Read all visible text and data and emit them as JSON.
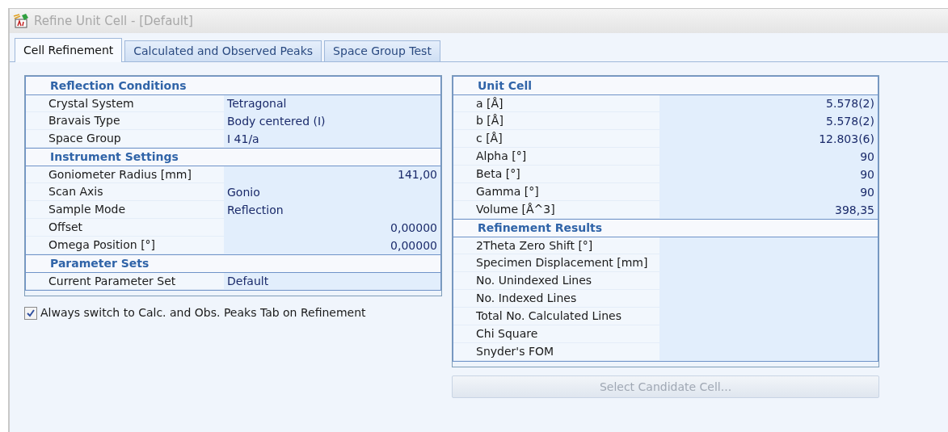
{
  "window": {
    "title": "Refine Unit Cell - [Default]"
  },
  "tabs": [
    {
      "label": "Cell Refinement",
      "selected": true
    },
    {
      "label": "Calculated and Observed Peaks",
      "selected": false
    },
    {
      "label": "Space Group Test",
      "selected": false
    }
  ],
  "left_grid": {
    "sections": [
      {
        "title": "Reflection Conditions",
        "rows": [
          {
            "label": "Crystal System",
            "value": "Tetragonal",
            "kind": "text"
          },
          {
            "label": "Bravais Type",
            "value": "Body centered (I)",
            "kind": "text"
          },
          {
            "label": "Space Group",
            "value": "I 41/a",
            "kind": "text"
          }
        ]
      },
      {
        "title": "Instrument Settings",
        "rows": [
          {
            "label": "Goniometer Radius [mm]",
            "value": "141,00",
            "kind": "number"
          },
          {
            "label": "Scan Axis",
            "value": "Gonio",
            "kind": "text"
          },
          {
            "label": "Sample Mode",
            "value": "Reflection",
            "kind": "text"
          },
          {
            "label": "Offset",
            "value": "0,00000",
            "kind": "number"
          },
          {
            "label": "Omega Position [°]",
            "value": "0,00000",
            "kind": "number"
          }
        ]
      },
      {
        "title": "Parameter Sets",
        "rows": [
          {
            "label": "Current Parameter Set",
            "value": "Default",
            "kind": "text"
          }
        ]
      }
    ]
  },
  "auto_switch": {
    "label": "Always switch to Calc. and Obs. Peaks Tab on Refinement",
    "checked": true
  },
  "right_grid": {
    "sections": [
      {
        "title": "Unit Cell",
        "rows": [
          {
            "label": "a [Å]",
            "value": "5.578(2)",
            "kind": "number"
          },
          {
            "label": "b [Å]",
            "value": "5.578(2)",
            "kind": "number"
          },
          {
            "label": "c [Å]",
            "value": "12.803(6)",
            "kind": "number"
          },
          {
            "label": "Alpha [°]",
            "value": "90",
            "kind": "number"
          },
          {
            "label": "Beta [°]",
            "value": "90",
            "kind": "number"
          },
          {
            "label": "Gamma [°]",
            "value": "90",
            "kind": "number"
          },
          {
            "label": "Volume [Å^3]",
            "value": "398,35",
            "kind": "number"
          }
        ]
      },
      {
        "title": "Refinement Results",
        "rows": [
          {
            "label": "2Theta Zero Shift [°]",
            "kind": "number"
          },
          {
            "label": "Specimen Displacement [mm]",
            "kind": "number"
          },
          {
            "label": "No. Unindexed Lines",
            "kind": "number"
          },
          {
            "label": "No. Indexed Lines",
            "kind": "number"
          },
          {
            "label": "Total No. Calculated Lines",
            "kind": "number"
          },
          {
            "label": "Chi Square",
            "kind": "number"
          },
          {
            "label": "Snyder's FOM",
            "kind": "number"
          }
        ]
      }
    ]
  },
  "select_button": {
    "label": "Select Candidate Cell...",
    "disabled": true
  }
}
